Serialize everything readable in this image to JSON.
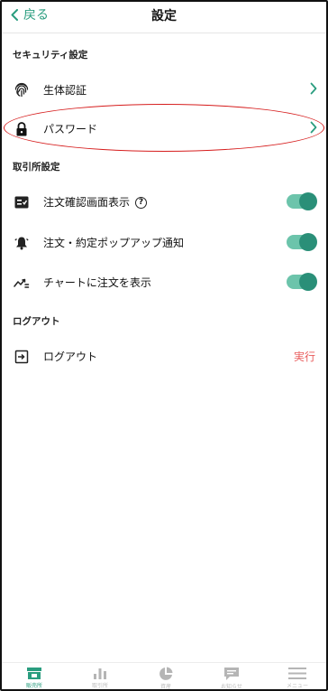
{
  "header": {
    "back_label": "戻る",
    "title": "設定"
  },
  "security": {
    "section_title": "セキュリティ設定",
    "biometric_label": "生体認証",
    "password_label": "パスワード"
  },
  "exchange": {
    "section_title": "取引所設定",
    "order_confirm_label": "注文確認画面表示",
    "order_popup_label": "注文・約定ポップアップ通知",
    "chart_orders_label": "チャートに注文を表示",
    "toggles": {
      "order_confirm": true,
      "order_popup": true,
      "chart_orders": true
    }
  },
  "logout": {
    "section_title": "ログアウト",
    "logout_label": "ログアウト",
    "action_label": "実行"
  },
  "tabbar": {
    "items": [
      {
        "icon": "store-icon",
        "label": "販売所",
        "active": true
      },
      {
        "icon": "bar-chart-icon",
        "label": "取引所",
        "active": false
      },
      {
        "icon": "pie-chart-icon",
        "label": "資産",
        "active": false
      },
      {
        "icon": "chat-icon",
        "label": "お知らせ",
        "active": false
      },
      {
        "icon": "menu-icon",
        "label": "メニュー",
        "active": false
      }
    ]
  },
  "colors": {
    "accent": "#2a9d7f",
    "toggle_track": "#6cc4ab",
    "toggle_knob": "#2a8f78",
    "danger": "#e85a5a",
    "annotation": "#d61d1d"
  }
}
